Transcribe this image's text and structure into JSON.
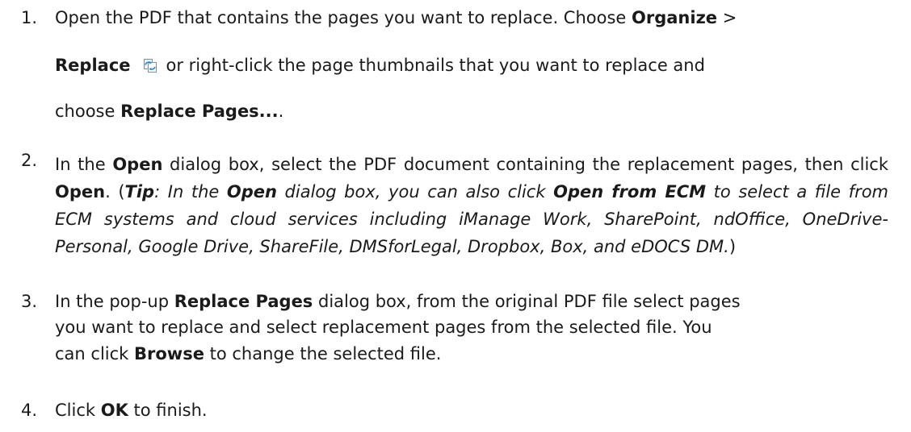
{
  "steps": [
    {
      "num": "1.",
      "l1_a": "Open the PDF that contains the pages you want to replace. Choose ",
      "l1_b": "Organize",
      "l1_c": " >",
      "l2_a": "Replace",
      "l2_icon": "replace-pages-icon",
      "l2_b": "or right-click the page thumbnails that you want to replace and",
      "l3_a": "choose ",
      "l3_b": "Replace Pages...",
      "l3_c": "."
    },
    {
      "num": "2.",
      "t1": "In the ",
      "t2": "Open",
      "t3": " dialog box, select the PDF document containing the replacement pages, then click ",
      "t4": "Open",
      "t5": ". (",
      "t6": "Tip",
      "t7": ": In the ",
      "t8": "Open",
      "t9": " dialog box, you can also click ",
      "t10": "Open from ECM",
      "t11": " to select a file from ECM systems and cloud services including iManage Work, SharePoint, ndOffice, OneDrive-Personal, Google Drive, ShareFile, DMSforLegal, Dropbox, Box, and eDOCS DM.",
      "t12": ")"
    },
    {
      "num": "3.",
      "l1_a": "In the pop-up ",
      "l1_b": "Replace Pages",
      "l1_c": " dialog box, from the original PDF file select pages",
      "l2": "you want to replace and select replacement pages from the selected file. You",
      "l3_a": "can click ",
      "l3_b": "Browse",
      "l3_c": " to change the selected file."
    },
    {
      "num": "4.",
      "a": "Click ",
      "b": "OK",
      "c": " to finish."
    }
  ]
}
